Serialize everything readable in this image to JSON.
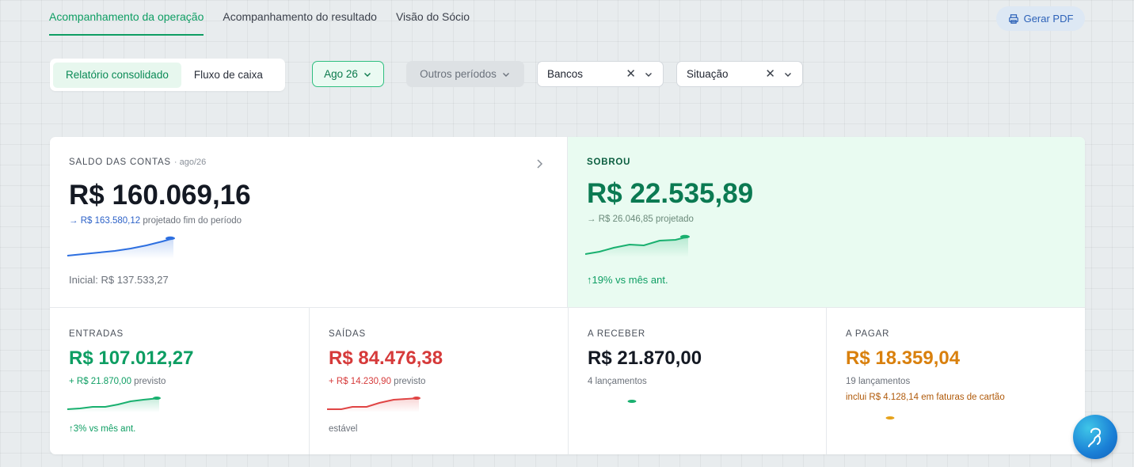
{
  "nav": {
    "tabs": [
      {
        "label": "Acompanhamento da operação",
        "active": true
      },
      {
        "label": "Acompanhamento do resultado",
        "active": false
      },
      {
        "label": "Visão do Sócio",
        "active": false
      }
    ],
    "pdf_label": "Gerar PDF"
  },
  "filters": {
    "segments": [
      {
        "label": "Relatório consolidado",
        "active": true
      },
      {
        "label": "Fluxo de caixa",
        "active": false
      }
    ],
    "month": "Ago 26",
    "periods": "Outros períodos",
    "banks": "Bancos",
    "status": "Situação"
  },
  "saldo": {
    "label": "SALDO DAS CONTAS",
    "period": "· ago/26",
    "value": "R$ 160.069,16",
    "projected_prefix": "→ R$ 163.580,12",
    "projected_suffix": "projetado fim do período",
    "initial": "Inicial: R$ 137.533,27"
  },
  "sobrou": {
    "label": "SOBROU",
    "value": "R$ 22.535,89",
    "projected": "→ R$ 26.046,85 projetado",
    "change": "↑19% vs mês ant."
  },
  "entradas": {
    "label": "ENTRADAS",
    "value": "R$ 107.012,27",
    "forecast_prefix": "+ R$ 21.870,00",
    "forecast_suffix": "previsto",
    "note": "↑3% vs mês ant."
  },
  "saidas": {
    "label": "SAÍDAS",
    "value": "R$ 84.476,38",
    "forecast_prefix": "+ R$ 14.230,90",
    "forecast_suffix": "previsto",
    "note": "estável"
  },
  "receber": {
    "label": "A RECEBER",
    "value": "R$ 21.870,00",
    "count": "4 lançamentos"
  },
  "pagar": {
    "label": "A PAGAR",
    "value": "R$ 18.359,04",
    "count": "19 lançamentos",
    "note": "inclui R$ 4.128,14 em faturas de cartão"
  },
  "colors": {
    "accent": "#0e9e63",
    "blue": "#2d62c8",
    "red": "#d63a3a",
    "orange": "#d9800d"
  }
}
